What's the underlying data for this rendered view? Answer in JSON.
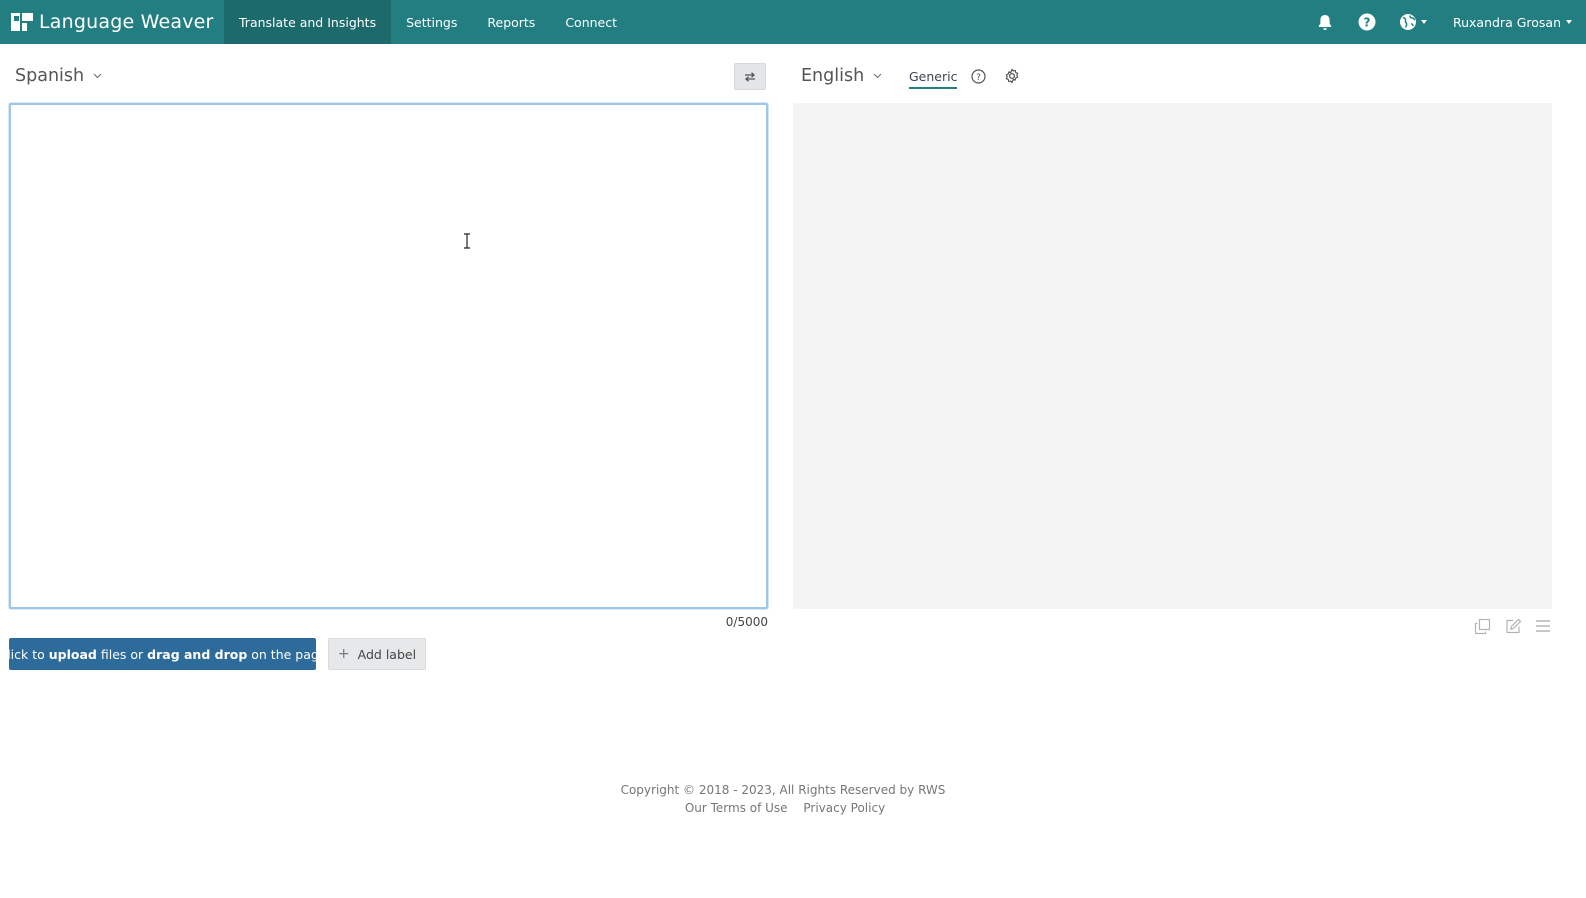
{
  "app": {
    "brand": "Language Weaver",
    "accent_color": "#227e80",
    "logo_icon": "language-weaver-logo"
  },
  "nav": {
    "items": [
      {
        "label": "Translate and Insights",
        "active": true
      },
      {
        "label": "Settings",
        "active": false
      },
      {
        "label": "Reports",
        "active": false
      },
      {
        "label": "Connect",
        "active": false
      }
    ]
  },
  "header_tools": {
    "bell_icon": "bell-icon",
    "help_icon": "help-icon",
    "globe_icon": "globe-icon",
    "user_name": "Ruxandra Grosan"
  },
  "translate": {
    "source_language": "Spanish",
    "target_language": "English",
    "model": "Generic",
    "source_text": "",
    "char_count": "0/5000",
    "swap_icon": "swap-arrows-icon"
  },
  "actions": {
    "upload_prefix": "Click to ",
    "upload_bold1": "upload",
    "upload_mid": " files or ",
    "upload_bold2": "drag and drop",
    "upload_suffix": " on the page",
    "add_label": "Add label"
  },
  "footer": {
    "copyright": "Copyright © 2018 - 2023, All Rights Reserved by RWS",
    "terms": "Our Terms of Use",
    "privacy": "Privacy Policy"
  }
}
